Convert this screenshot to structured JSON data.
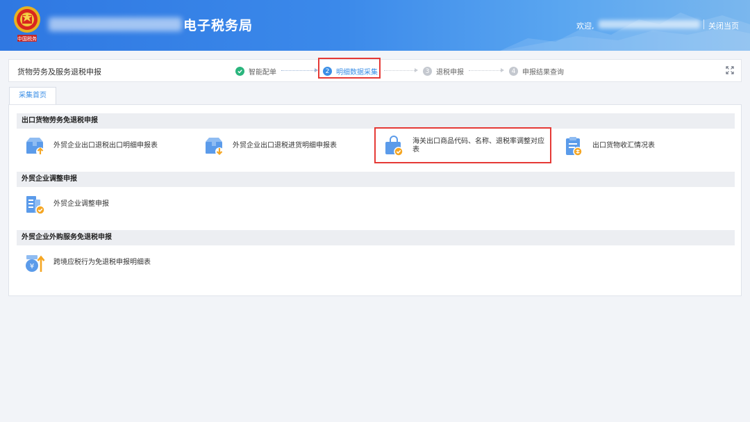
{
  "header": {
    "bureau_title": "电子税务局",
    "welcome": "欢迎,",
    "close_page": "关闭当页",
    "emblem_caption": "中国税务"
  },
  "stepbar": {
    "page_name": "货物劳务及服务退税申报",
    "steps": [
      {
        "num": "",
        "label": "智能配单",
        "state": "done"
      },
      {
        "num": "2",
        "label": "明细数据采集",
        "state": "active"
      },
      {
        "num": "3",
        "label": "退税申报",
        "state": "pending"
      },
      {
        "num": "4",
        "label": "申报结果查询",
        "state": "pending"
      }
    ]
  },
  "tab": {
    "label": "采集首页"
  },
  "sections": [
    {
      "title": "出口货物劳务免退税申报",
      "items": [
        {
          "label": "外贸企业出口退税出口明细申报表",
          "icon": "box-upload-icon"
        },
        {
          "label": "外贸企业出口退税进货明细申报表",
          "icon": "box-download-icon"
        },
        {
          "label": "海关出口商品代码、名称、退税率调整对应表",
          "icon": "bag-check-icon"
        },
        {
          "label": "出口货物收汇情况表",
          "icon": "clipboard-money-icon"
        }
      ]
    },
    {
      "title": "外贸企业调整申报",
      "items": [
        {
          "label": "外贸企业调整申报",
          "icon": "document-check-icon"
        }
      ]
    },
    {
      "title": "外贸企业外购服务免退税申报",
      "items": [
        {
          "label": "跨境应税行为免退税申报明细表",
          "icon": "coin-arrow-icon"
        }
      ]
    }
  ],
  "colors": {
    "accent": "#3a8ee6",
    "icon_blue": "#5b9bea",
    "icon_orange": "#f5a623",
    "done_green": "#2ab57d",
    "highlight_red": "#e53935"
  }
}
